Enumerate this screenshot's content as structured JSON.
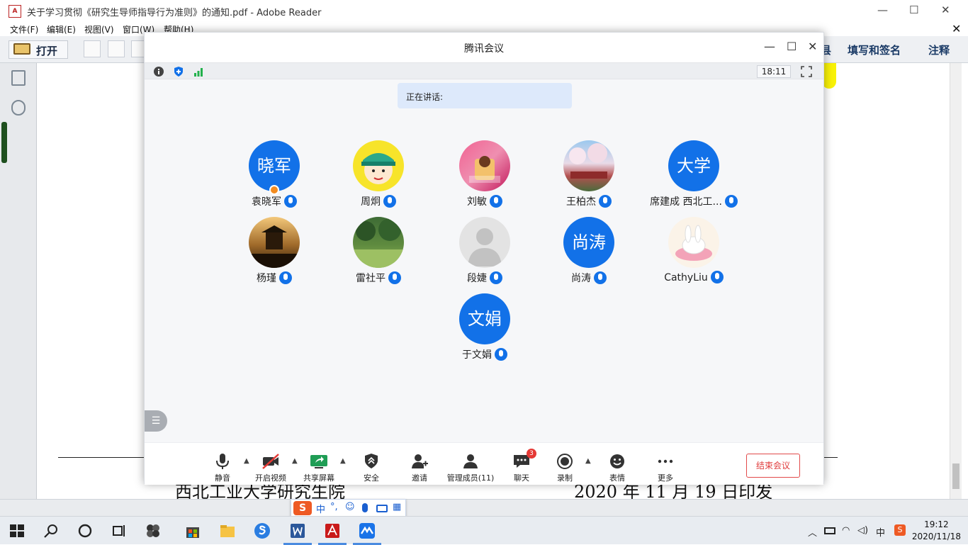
{
  "reader": {
    "title": "关于学习贯彻《研究生导师指导行为准则》的通知.pdf - Adobe Reader",
    "menu": [
      "文件(F)",
      "编辑(E)",
      "视图(V)",
      "窗口(W)",
      "帮助(H)"
    ],
    "toolbar": {
      "open_label": "打开",
      "fill_sign_label": "填写和签名",
      "comment_label": "注释"
    },
    "doc_footer_left": "西北工业大学研究生院",
    "doc_footer_right": "2020 年 11 月 19 日印发"
  },
  "meeting": {
    "window_title": "腾讯会议",
    "time": "18:11",
    "speaking_label": "正在讲话:",
    "participants": [
      {
        "name": "袁晓军",
        "avatar_text": "晓军"
      },
      {
        "name": "周炯",
        "avatar_text": ""
      },
      {
        "name": "刘敏",
        "avatar_text": ""
      },
      {
        "name": "王柏杰",
        "avatar_text": ""
      },
      {
        "name": "席建成  西北工...",
        "avatar_text": "大学"
      },
      {
        "name": "杨瑾",
        "avatar_text": ""
      },
      {
        "name": "雷社平",
        "avatar_text": ""
      },
      {
        "name": "段婕",
        "avatar_text": ""
      },
      {
        "name": "尚涛",
        "avatar_text": "尚涛"
      },
      {
        "name": "CathyLiu",
        "avatar_text": ""
      },
      {
        "name": "于文娟",
        "avatar_text": "文娟"
      }
    ],
    "controls": {
      "mute": "静音",
      "video": "开启视频",
      "share": "共享屏幕",
      "security": "安全",
      "invite": "邀请",
      "members": "管理成员(11)",
      "chat": "聊天",
      "chat_badge": "3",
      "record": "录制",
      "emoji": "表情",
      "more": "更多",
      "end": "结束会议"
    },
    "accent_color": "#1271e8"
  },
  "ime": {
    "mode": "中"
  },
  "taskbar": {
    "time": "19:12",
    "date": "2020/11/18",
    "ime_indicator": "中"
  }
}
